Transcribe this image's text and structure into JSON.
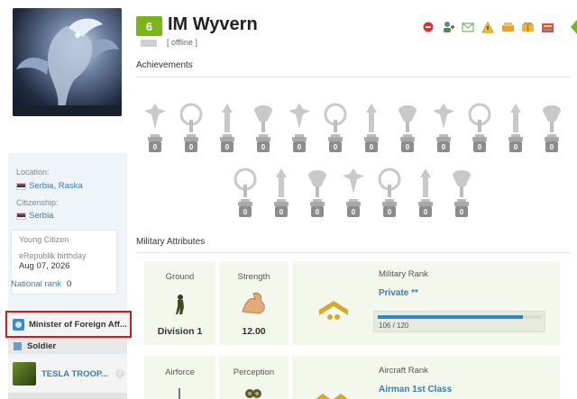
{
  "profile": {
    "level": "6",
    "name": "IM Wyvern",
    "status": "[ offline ]",
    "location_label": "Location:",
    "location": "Serbia, Raska",
    "citizenship_label": "Citizenship:",
    "citizenship": "Serbia",
    "title": "Young Citizen",
    "birthday_label": "eRepublik birthday",
    "birthday": "Aug 07, 2026",
    "national_rank_label": "National rank",
    "national_rank": "0",
    "ministry": "Minister of Foreign Aff...",
    "role": "Soldier",
    "unit": "TESLA TROOP...",
    "icons": {
      "avatar": "dragon-avatar",
      "flag": "serbia-flag-icon"
    }
  },
  "header_actions": [
    {
      "name": "remove-friend",
      "icon": "remove-icon",
      "color": "#d9362b"
    },
    {
      "name": "add-friend",
      "icon": "add-friend-icon",
      "color": "#4a8f3a"
    },
    {
      "name": "message",
      "icon": "message-icon",
      "color": "#62a84a"
    },
    {
      "name": "report",
      "icon": "warning-icon",
      "color": "#e0a11b"
    },
    {
      "name": "donate",
      "icon": "donate-icon",
      "color": "#d18b1a"
    },
    {
      "name": "gift",
      "icon": "gift-icon",
      "color": "#d9a21c"
    },
    {
      "name": "exchange",
      "icon": "exchange-icon",
      "color": "#c0392b"
    }
  ],
  "achievements": {
    "title": "Achievements",
    "row1": [
      "0",
      "0",
      "0",
      "0",
      "0",
      "0",
      "0",
      "0",
      "0",
      "0",
      "0",
      "0"
    ],
    "row2": [
      "0",
      "0",
      "0",
      "0",
      "0",
      "0",
      "0"
    ]
  },
  "military": {
    "title": "Military Attributes",
    "ground_label": "Ground",
    "ground_division": "Division 1",
    "strength_label": "Strength",
    "strength": "12.00",
    "military_rank_label": "Military Rank",
    "military_rank": "Private **",
    "rank_progress_text": "106 / 120",
    "rank_progress_fraction": 0.883,
    "airforce_label": "Airforce",
    "perception_label": "Perception",
    "aircraft_rank_label": "Aircraft Rank",
    "aircraft_rank": "Airman 1st Class"
  },
  "colors": {
    "level_green": "#7ab51d",
    "link_blue": "#3d7cab",
    "progress_blue": "#2f87c9",
    "highlight_red": "#d11b1b"
  }
}
